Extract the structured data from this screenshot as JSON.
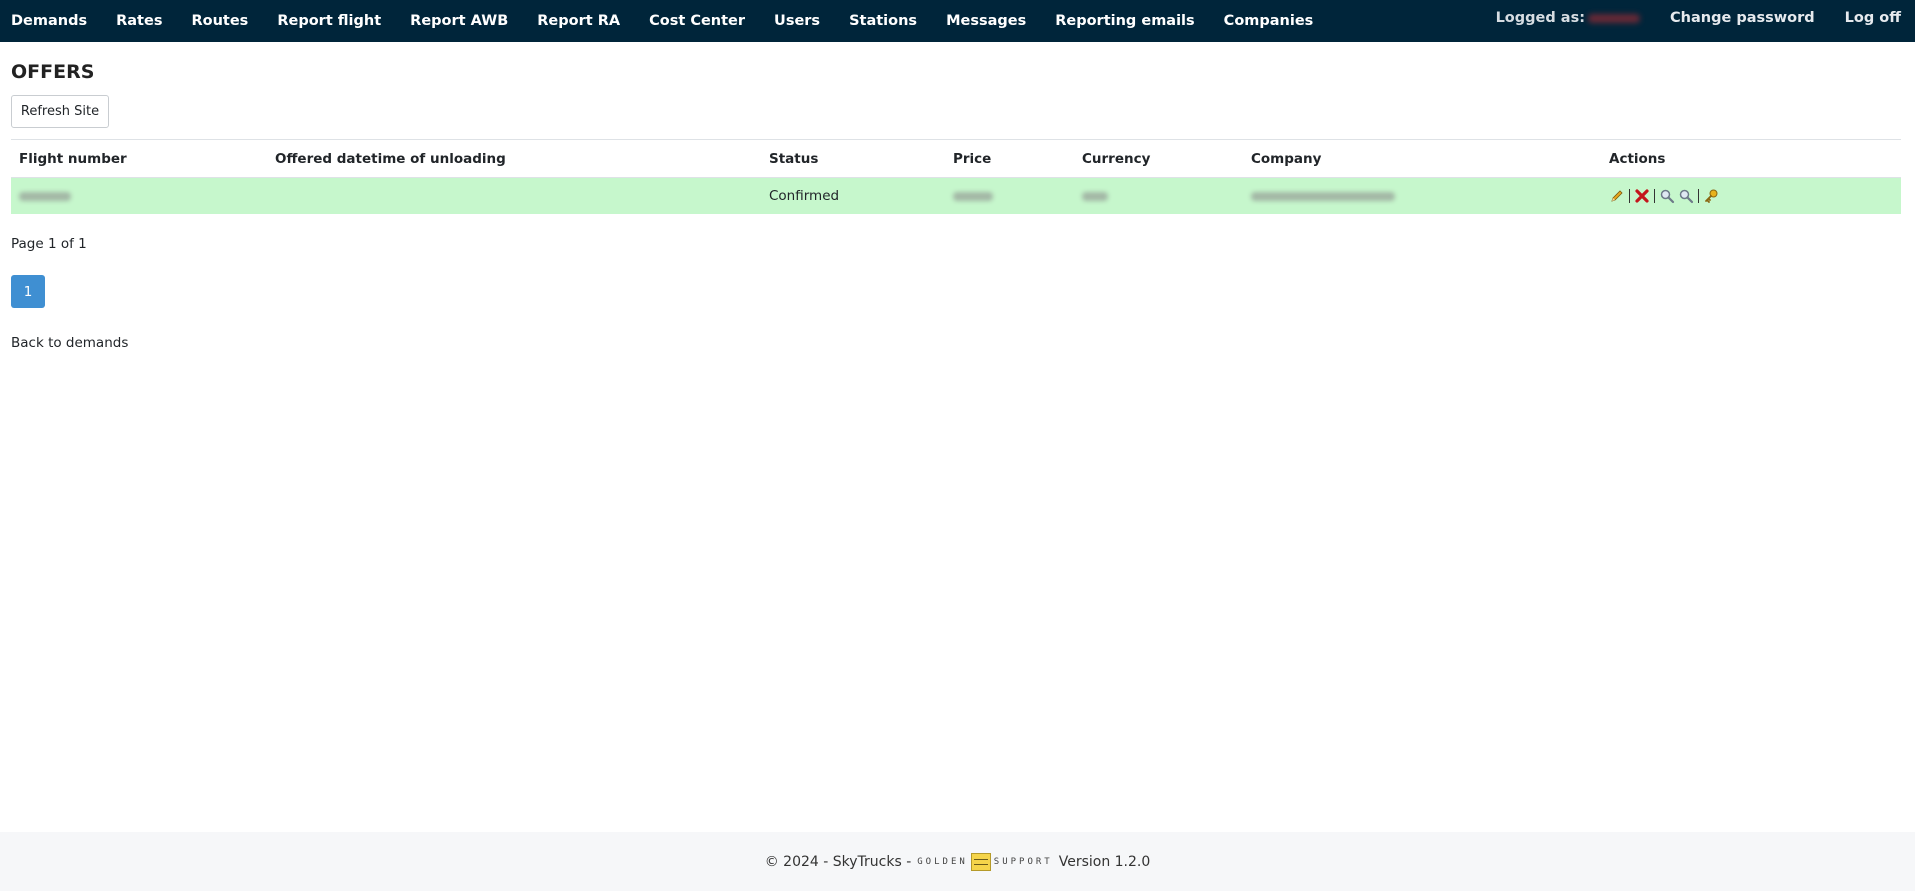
{
  "nav": {
    "items": [
      "Demands",
      "Rates",
      "Routes",
      "Report flight",
      "Report AWB",
      "Report RA",
      "Cost Center",
      "Users",
      "Stations",
      "Messages",
      "Reporting emails",
      "Companies"
    ],
    "logged_as_label": "Logged as:",
    "change_password": "Change password",
    "log_off": "Log off"
  },
  "page": {
    "title": "OFFERS",
    "refresh_label": "Refresh Site"
  },
  "table": {
    "headers": [
      "Flight number",
      "Offered datetime of unloading",
      "Status",
      "Price",
      "Currency",
      "Company",
      "Actions"
    ],
    "rows": [
      {
        "status": "Confirmed",
        "row_color": "#c6f7cc",
        "actions": [
          "pencil-icon",
          "delete-icon",
          "search-icon",
          "search-icon",
          "key-icon"
        ]
      }
    ]
  },
  "pager": {
    "summary": "Page 1 of 1",
    "current_page": "1"
  },
  "back_link": "Back to demands",
  "footer": {
    "copyright": "© 2024 - SkyTrucks -",
    "logo_left": "GOLDEN",
    "logo_right": "SUPPORT",
    "version": "Version 1.2.0"
  },
  "colors": {
    "navbar": "#00253a",
    "accent": "#3f8fd2",
    "confirmed_row": "#c6f7cc"
  }
}
